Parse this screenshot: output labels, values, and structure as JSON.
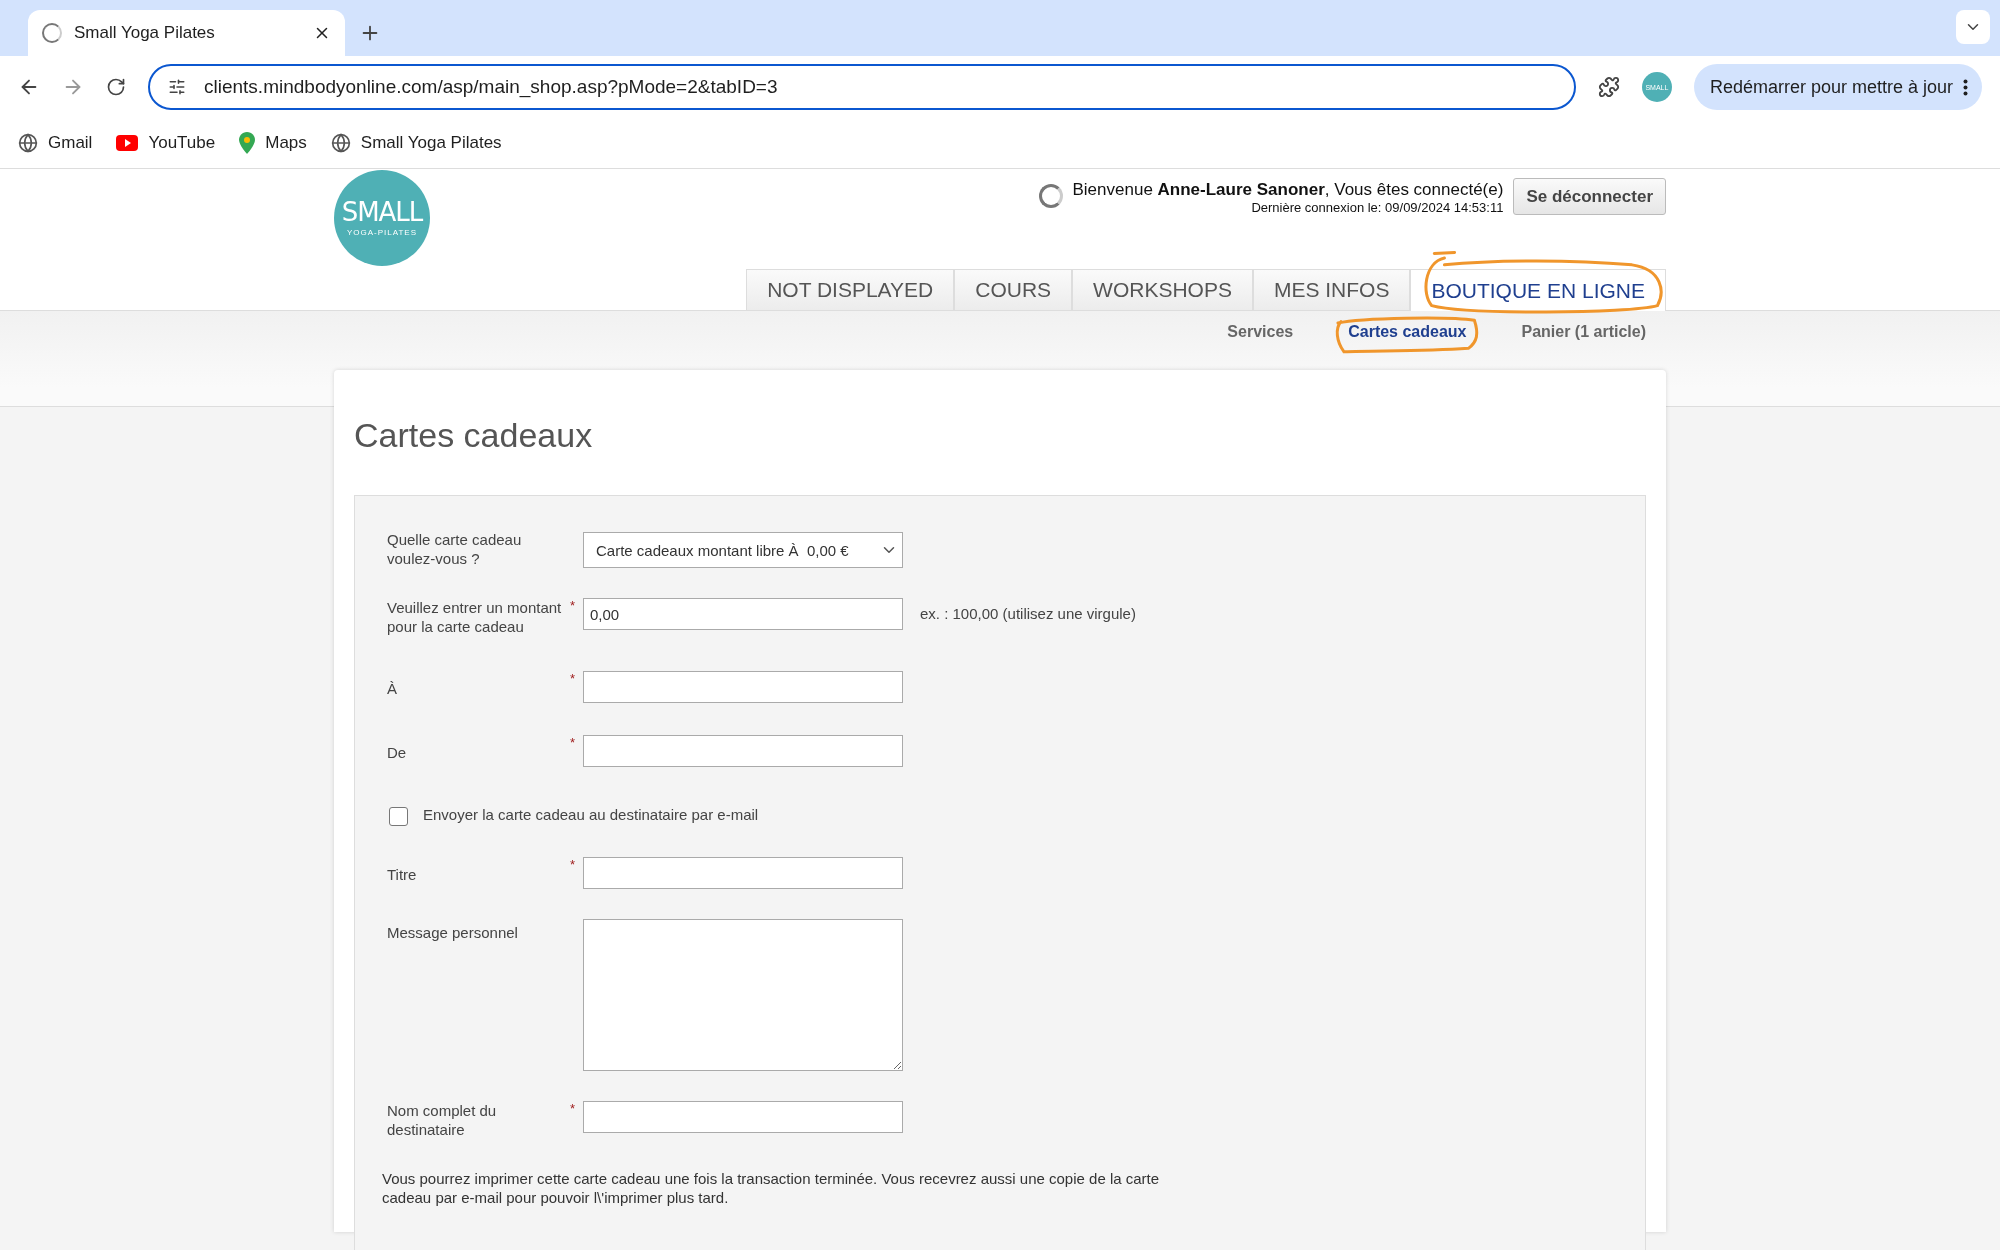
{
  "browser": {
    "tab_title": "Small Yoga Pilates",
    "url": "clients.mindbodyonline.com/asp/main_shop.asp?pMode=2&tabID=3",
    "update_button": "Redémarrer pour mettre à jour",
    "profile_badge": "SMALL",
    "bookmarks": [
      {
        "label": "Gmail",
        "kind": "globe"
      },
      {
        "label": "YouTube",
        "kind": "video"
      },
      {
        "label": "Maps",
        "kind": "pin"
      },
      {
        "label": "Small Yoga Pilates",
        "kind": "globe"
      }
    ]
  },
  "header": {
    "logo_title": "SMALL",
    "logo_subtitle": "YOGA-PILATES",
    "welcome": "Bienvenue **Anne-Laure Sanoner**, Vous êtes connecté(e)",
    "last_login": "Dernière connexion le: 09/09/2024 14:53:11",
    "logout_button": "Se déconnecter"
  },
  "nav_tabs": [
    {
      "label": "NOT DISPLAYED",
      "selected": false,
      "circled": false
    },
    {
      "label": "COURS",
      "selected": false,
      "circled": false
    },
    {
      "label": "WORKSHOPS",
      "selected": false,
      "circled": false
    },
    {
      "label": "MES INFOS",
      "selected": false,
      "circled": false
    },
    {
      "label": "BOUTIQUE EN LIGNE",
      "selected": true,
      "circled": true
    }
  ],
  "sub_nav": [
    {
      "label": "Services",
      "selected": false,
      "circled": false
    },
    {
      "label": "Cartes cadeaux",
      "selected": true,
      "circled": true
    },
    {
      "label": "Panier (1 article)",
      "selected": false,
      "circled": false
    }
  ],
  "page_title": "Cartes cadeaux",
  "form": {
    "required_mark": "*",
    "fields": [
      {
        "kind": "select",
        "label": "Quelle carte cadeau voulez-vous ?",
        "required": false,
        "value": "Carte cadeaux montant libre À  0,00 €"
      },
      {
        "kind": "text",
        "label": "Veuillez entrer un montant pour la carte cadeau",
        "required": true,
        "value": "0,00",
        "hint": "ex. : 100,00 (utilisez une virgule)"
      },
      {
        "kind": "text",
        "label": "À",
        "required": true
      },
      {
        "kind": "text",
        "label": "De",
        "required": true
      },
      {
        "kind": "checkbox",
        "label": "Envoyer la carte cadeau au destinataire par e-mail",
        "checked": false
      },
      {
        "kind": "text",
        "label": "Titre",
        "required": true
      },
      {
        "kind": "textarea",
        "label": "Message personnel",
        "required": false
      },
      {
        "kind": "text",
        "label": "Nom complet du destinataire",
        "required": true
      }
    ],
    "note": "Vous pourrez imprimer cette carte cadeau une fois la transaction terminée. Vous recevrez aussi une copie de la carte cadeau par e-mail pour pouvoir l\\'imprimer plus tard."
  }
}
